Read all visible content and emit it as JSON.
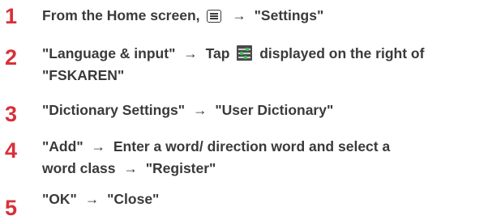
{
  "steps": [
    {
      "number": "1",
      "text_before": "From the Home screen,",
      "icon": "menu-icon",
      "arrow": "→",
      "text_after": "\"Settings\""
    },
    {
      "number": "2",
      "text_1": "\"Language & input\"",
      "arrow": "→",
      "text_2": "Tap",
      "icon": "settings-sliders-icon",
      "text_3": "displayed on the right of",
      "line2": "\"FSKAREN\""
    },
    {
      "number": "3",
      "text_1": "\"Dictionary Settings\"",
      "arrow": "→",
      "text_2": "\"User Dictionary\""
    },
    {
      "number": "4",
      "text_1": "\"Add\"",
      "arrow": "→",
      "text_2": "Enter a word/ direction word and select a",
      "line2_text": "word class",
      "line2_arrow": "→",
      "line2_end": "\"Register\""
    },
    {
      "number": "5",
      "text_1": "\"OK\"",
      "arrow": "→",
      "text_2": "\"Close\""
    }
  ],
  "colors": {
    "step_number": "#d9303a",
    "text": "#3a3a3a"
  }
}
